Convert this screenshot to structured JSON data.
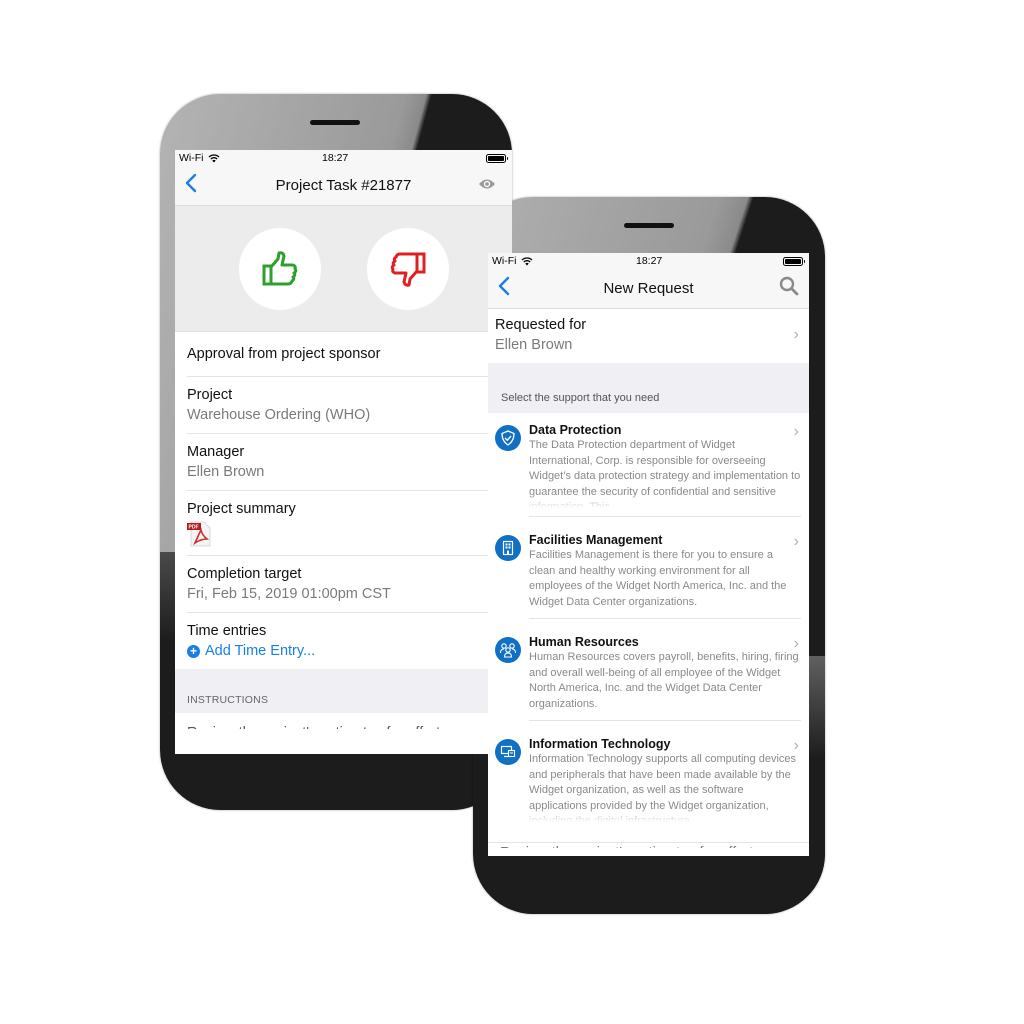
{
  "phone_task": {
    "status_bar": {
      "network": "Wi-Fi",
      "time": "18:27"
    },
    "nav": {
      "title": "Project Task #21877",
      "back_icon": "chevron-left-icon",
      "action_icon": "eye-icon"
    },
    "actions": {
      "approve_icon": "thumbs-up-icon",
      "reject_icon": "thumbs-down-icon",
      "approve_color": "#2ca02c",
      "reject_color": "#e02020"
    },
    "heading": "Approval from project sponsor",
    "fields": [
      {
        "label": "Project",
        "value": "Warehouse Ordering (WHO)"
      },
      {
        "label": "Manager",
        "value": "Ellen Brown"
      },
      {
        "label": "Project summary",
        "attachment_icon": "pdf-icon"
      },
      {
        "label": "Completion target",
        "value": "Fri, Feb 15, 2019 01:00pm CST"
      },
      {
        "label": "Time entries",
        "link": "Add Time Entry..."
      }
    ],
    "section_header": "INSTRUCTIONS",
    "instructions_preview": "Review the project's estimates for effort"
  },
  "phone_request": {
    "status_bar": {
      "network": "Wi-Fi",
      "time": "18:27"
    },
    "nav": {
      "title": "New Request",
      "back_icon": "chevron-left-icon",
      "action_icon": "search-icon"
    },
    "requested_for": {
      "label": "Requested for",
      "value": "Ellen Brown"
    },
    "section_header": "Select the support that you need",
    "services": [
      {
        "title": "Data Protection",
        "icon": "shield-check-icon",
        "description": "The Data Protection department of Widget International, Corp. is responsible for overseeing Widget’s data protection strategy and implementation to guarantee the security of confidential and sensitive information. This"
      },
      {
        "title": "Facilities Management",
        "icon": "building-icon",
        "description": "Facilities Management is there for you to ensure a clean and healthy working environment for all employees of the Widget North America, Inc. and the Widget Data Center organizations."
      },
      {
        "title": "Human Resources",
        "icon": "people-icon",
        "description": "Human Resources covers payroll, benefits, hiring, firing and overall well-being of all employee of the Widget North America, Inc. and the Widget Data Center organizations."
      },
      {
        "title": "Information Technology",
        "icon": "computer-icon",
        "description": "Information Technology supports all computing devices and peripherals that have been made available by the Widget organization, as well as the software applications provided by the Widget organization, including the digital infrastructure"
      }
    ],
    "footer_preview": "Review the project's estimates for effort",
    "accent_color": "#1070c4"
  }
}
